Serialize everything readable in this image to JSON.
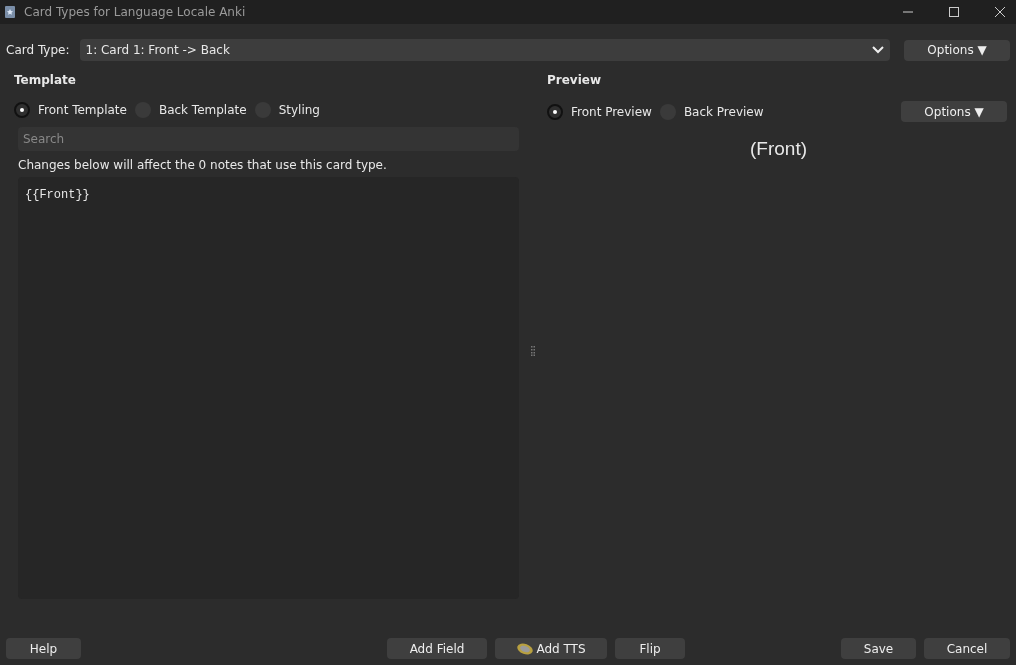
{
  "window": {
    "title": "Card Types for Language Locale Anki"
  },
  "card_type": {
    "label": "Card Type:",
    "value": "1: Card 1: Front -> Back",
    "options_button": "Options ▼"
  },
  "template": {
    "heading": "Template",
    "radios": [
      {
        "label": "Front Template",
        "selected": true
      },
      {
        "label": "Back Template",
        "selected": false
      },
      {
        "label": "Styling",
        "selected": false
      }
    ],
    "search": {
      "placeholder": "Search"
    },
    "notice": "Changes below will affect the 0 notes that use this card type.",
    "code": "{{Front}}"
  },
  "preview": {
    "heading": "Preview",
    "radios": [
      {
        "label": "Front Preview",
        "selected": true
      },
      {
        "label": "Back Preview",
        "selected": false
      }
    ],
    "options_button": "Options ▼",
    "content": "(Front)"
  },
  "buttons_left": [
    {
      "label": "Help"
    }
  ],
  "buttons_center": [
    {
      "label": "Add Field",
      "kind": "plain"
    },
    {
      "label": "Add TTS",
      "kind": "speaker"
    },
    {
      "label": "Flip",
      "kind": "plain"
    }
  ],
  "buttons_right": [
    {
      "label": "Save"
    },
    {
      "label": "Cancel"
    }
  ]
}
